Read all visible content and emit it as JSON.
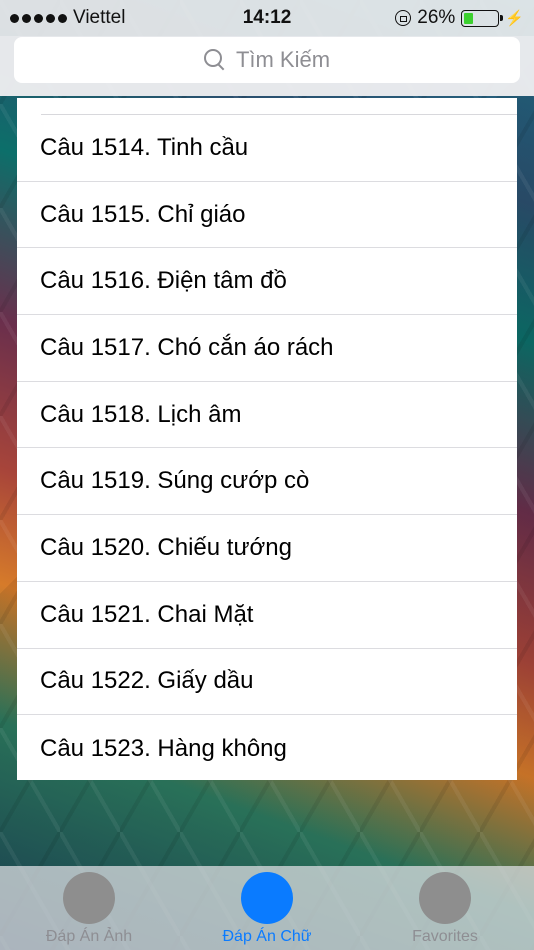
{
  "status_bar": {
    "carrier": "Viettel",
    "time": "14:12",
    "battery_percent": "26%",
    "battery_level": 0.26,
    "signal_dots": 5
  },
  "search": {
    "placeholder": "Tìm Kiếm"
  },
  "list": {
    "items": [
      "Câu 1514. Tinh cầu",
      "Câu 1515. Chỉ giáo",
      "Câu 1516. Điện tâm đồ",
      "Câu 1517. Chó cắn áo rách",
      "Câu 1518. Lịch âm",
      "Câu 1519. Súng cướp cò",
      "Câu 1520. Chiếu tướng",
      "Câu 1521. Chai Mặt",
      "Câu 1522. Giấy dầu",
      "Câu 1523. Hàng không"
    ]
  },
  "tab_bar": {
    "tabs": [
      {
        "label": "Đáp Án Ảnh",
        "active": false
      },
      {
        "label": "Đáp Án Chữ",
        "active": true
      },
      {
        "label": "Favorites",
        "active": false
      }
    ]
  },
  "colors": {
    "accent": "#0a7bff",
    "inactive": "#8e8e93",
    "battery": "#3cd02f"
  }
}
